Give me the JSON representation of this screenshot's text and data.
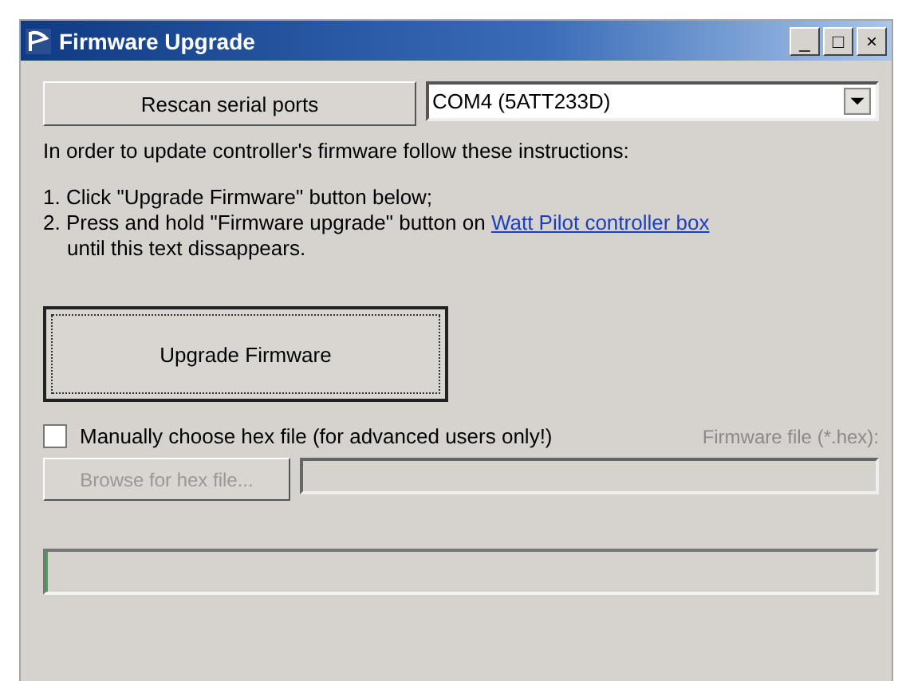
{
  "window": {
    "title": "Firmware Upgrade",
    "controls": [
      "_",
      "□",
      "×"
    ]
  },
  "rescan_button": {
    "label": "Rescan serial ports"
  },
  "port_select": {
    "value": "COM4 (5ATT233D)"
  },
  "instructions": {
    "intro": "In order to update controller's firmware follow these instructions:",
    "steps": [
      {
        "text": "1. Click \"Upgrade Firmware\" button below;"
      },
      {
        "text": "2. Press and hold \"Firmware upgrade\" button on ",
        "link": "Watt Pilot controller box"
      },
      {
        "text": "until this text dissappears.",
        "indent": true
      }
    ]
  },
  "upgrade_button": {
    "label": "Upgrade Firmware"
  },
  "manual_checkbox": {
    "label": "Manually choose hex file (for advanced users only!)",
    "checked": false
  },
  "firmware_file": {
    "label": "Firmware file (*.hex):",
    "disabled": true
  },
  "browse_button": {
    "label": "Browse for hex file...",
    "disabled": true
  },
  "progress": {
    "level": 0
  }
}
